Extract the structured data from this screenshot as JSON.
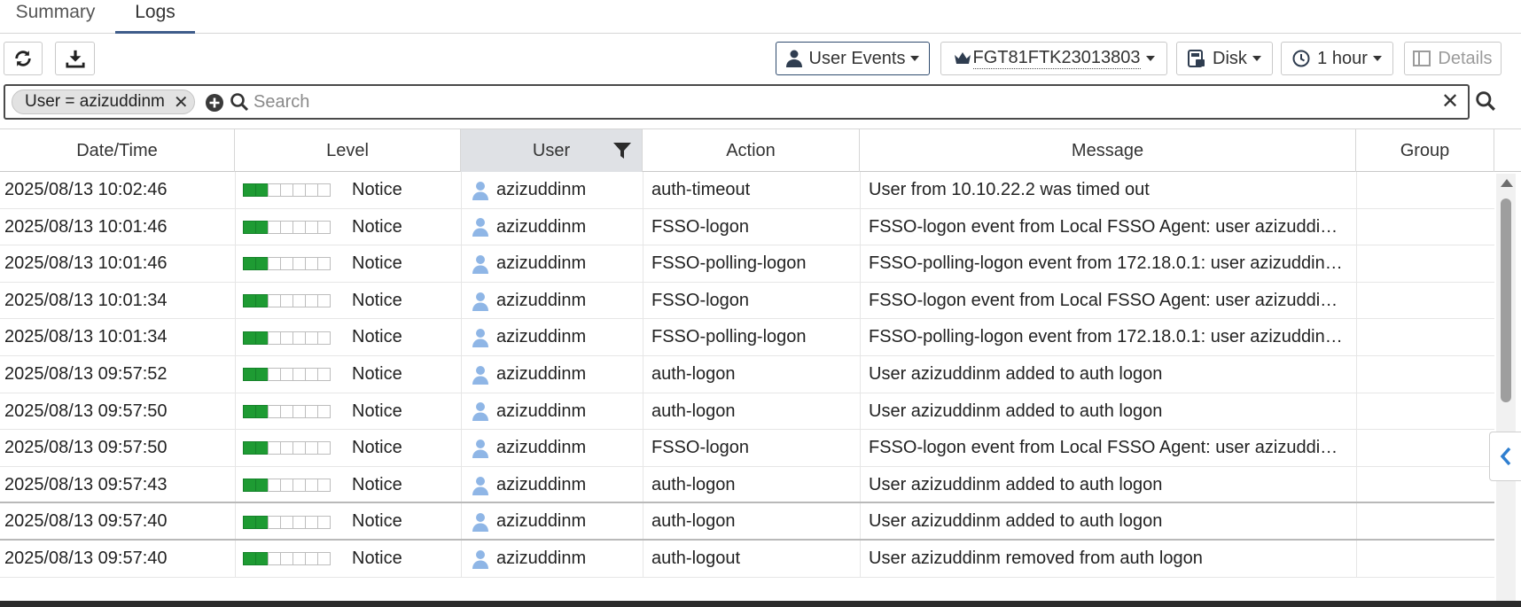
{
  "tabs": [
    {
      "label": "Summary"
    },
    {
      "label": "Logs"
    }
  ],
  "toolbar": {
    "event_type": "User Events",
    "device": "FGT81FTK23013803",
    "source": "Disk",
    "time_range": "1 hour",
    "details": "Details"
  },
  "filter": {
    "chip": "User = azizuddinm",
    "placeholder": "Search"
  },
  "columns": [
    "Date/Time",
    "Level",
    "User",
    "Action",
    "Message",
    "Group"
  ],
  "rows": [
    {
      "datetime": "2025/08/13 10:02:46",
      "level": "Notice",
      "user": "azizuddinm",
      "action": "auth-timeout",
      "message": "User from 10.10.22.2 was timed out",
      "group": ""
    },
    {
      "datetime": "2025/08/13 10:01:46",
      "level": "Notice",
      "user": "azizuddinm",
      "action": "FSSO-logon",
      "message": "FSSO-logon event from Local FSSO Agent: user azizuddinm l...",
      "group": ""
    },
    {
      "datetime": "2025/08/13 10:01:46",
      "level": "Notice",
      "user": "azizuddinm",
      "action": "FSSO-polling-logon",
      "message": "FSSO-polling-logon event from 172.18.0.1: user azizuddinm ...",
      "group": ""
    },
    {
      "datetime": "2025/08/13 10:01:34",
      "level": "Notice",
      "user": "azizuddinm",
      "action": "FSSO-logon",
      "message": "FSSO-logon event from Local FSSO Agent: user azizuddinm l...",
      "group": ""
    },
    {
      "datetime": "2025/08/13 10:01:34",
      "level": "Notice",
      "user": "azizuddinm",
      "action": "FSSO-polling-logon",
      "message": "FSSO-polling-logon event from 172.18.0.1: user azizuddinm ...",
      "group": ""
    },
    {
      "datetime": "2025/08/13 09:57:52",
      "level": "Notice",
      "user": "azizuddinm",
      "action": "auth-logon",
      "message": "User azizuddinm added to auth logon",
      "group": ""
    },
    {
      "datetime": "2025/08/13 09:57:50",
      "level": "Notice",
      "user": "azizuddinm",
      "action": "auth-logon",
      "message": "User azizuddinm added to auth logon",
      "group": ""
    },
    {
      "datetime": "2025/08/13 09:57:50",
      "level": "Notice",
      "user": "azizuddinm",
      "action": "FSSO-logon",
      "message": "FSSO-logon event from Local FSSO Agent: user azizuddinm l...",
      "group": ""
    },
    {
      "datetime": "2025/08/13 09:57:43",
      "level": "Notice",
      "user": "azizuddinm",
      "action": "auth-logon",
      "message": "User azizuddinm added to auth logon",
      "group": ""
    },
    {
      "datetime": "2025/08/13 09:57:40",
      "level": "Notice",
      "user": "azizuddinm",
      "action": "auth-logon",
      "message": "User azizuddinm added to auth logon",
      "group": ""
    },
    {
      "datetime": "2025/08/13 09:57:40",
      "level": "Notice",
      "user": "azizuddinm",
      "action": "auth-logout",
      "message": "User azizuddinm removed from auth logon",
      "group": ""
    }
  ],
  "level_bars": {
    "filled": 2,
    "total": 7
  },
  "colors": {
    "accent": "#3e5c8a",
    "level_on": "#1e9b33",
    "user_icon": "#8fb6e6"
  },
  "icons": [
    "refresh-icon",
    "download-icon",
    "user-icon",
    "crown-icon",
    "disk-icon",
    "clock-icon",
    "details-icon",
    "add-filter-icon",
    "search-icon",
    "close-icon",
    "filter-icon",
    "chevron-left-icon"
  ]
}
